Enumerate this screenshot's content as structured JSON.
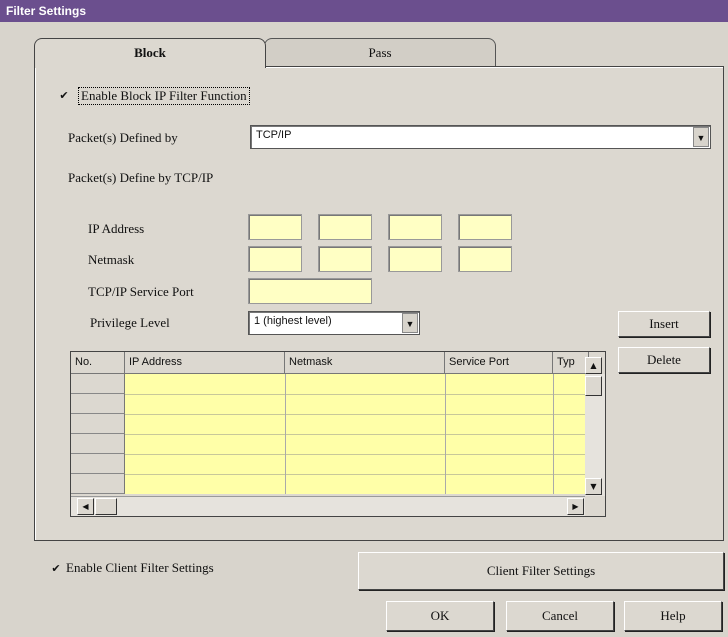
{
  "window": {
    "title": "Filter Settings"
  },
  "tabs": [
    {
      "label": "Block",
      "active": true
    },
    {
      "label": "Pass",
      "active": false
    }
  ],
  "block": {
    "enable_checkbox": {
      "label": "Enable Block IP Filter Function",
      "checked": true
    },
    "packets_defined_by": {
      "label": "Packet(s) Defined by",
      "value": "TCP/IP"
    },
    "section_label": "Packet(s) Define by TCP/IP",
    "ip_address_label": "IP Address",
    "netmask_label": "Netmask",
    "service_port_label": "TCP/IP Service Port",
    "privilege_level": {
      "label": "Privilege Level",
      "value": "1 (highest level)"
    },
    "insert_button": "Insert",
    "delete_button": "Delete",
    "table": {
      "columns": [
        "No.",
        "IP Address",
        "Netmask",
        "Service Port",
        "Typ"
      ],
      "rows": []
    }
  },
  "client_filter": {
    "checkbox": {
      "label": "Enable Client Filter Settings",
      "checked": true
    },
    "button": "Client Filter Settings"
  },
  "footer": {
    "ok": "OK",
    "cancel": "Cancel",
    "help": "Help"
  },
  "colors": {
    "titlebar": "#6b4f8e",
    "field_bg": "#ffffc4",
    "grid_bg": "#ffffa8",
    "dialog_bg": "#d8d4cc"
  }
}
